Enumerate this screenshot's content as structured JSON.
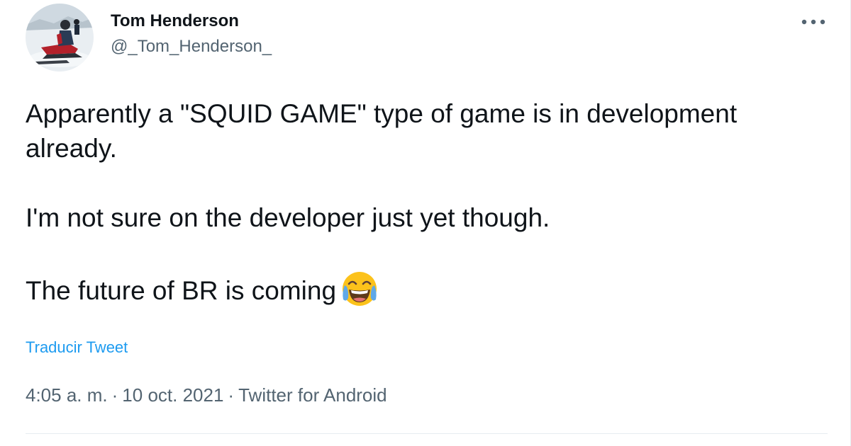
{
  "author": {
    "display_name": "Tom Henderson",
    "handle": "@_Tom_Henderson_",
    "avatar_icon": "snowmobile-photo-avatar"
  },
  "menu": {
    "more_icon": "more-horizontal-icon"
  },
  "tweet": {
    "paragraphs": [
      "Apparently a \"SQUID GAME\" type of game is in development already.",
      "I'm not sure on the developer just yet though.",
      "The future of BR is coming"
    ],
    "emoji": "face-with-tears-of-joy",
    "translate_label": "Traducir Tweet"
  },
  "meta": {
    "time": "4:05 a. m.",
    "separator": "·",
    "date": "10 oct. 2021",
    "source": "Twitter for Android"
  },
  "colors": {
    "link": "#1d9bf0",
    "secondary_text": "#536471",
    "primary_text": "#0f1419",
    "divider": "#e6ecf0"
  }
}
